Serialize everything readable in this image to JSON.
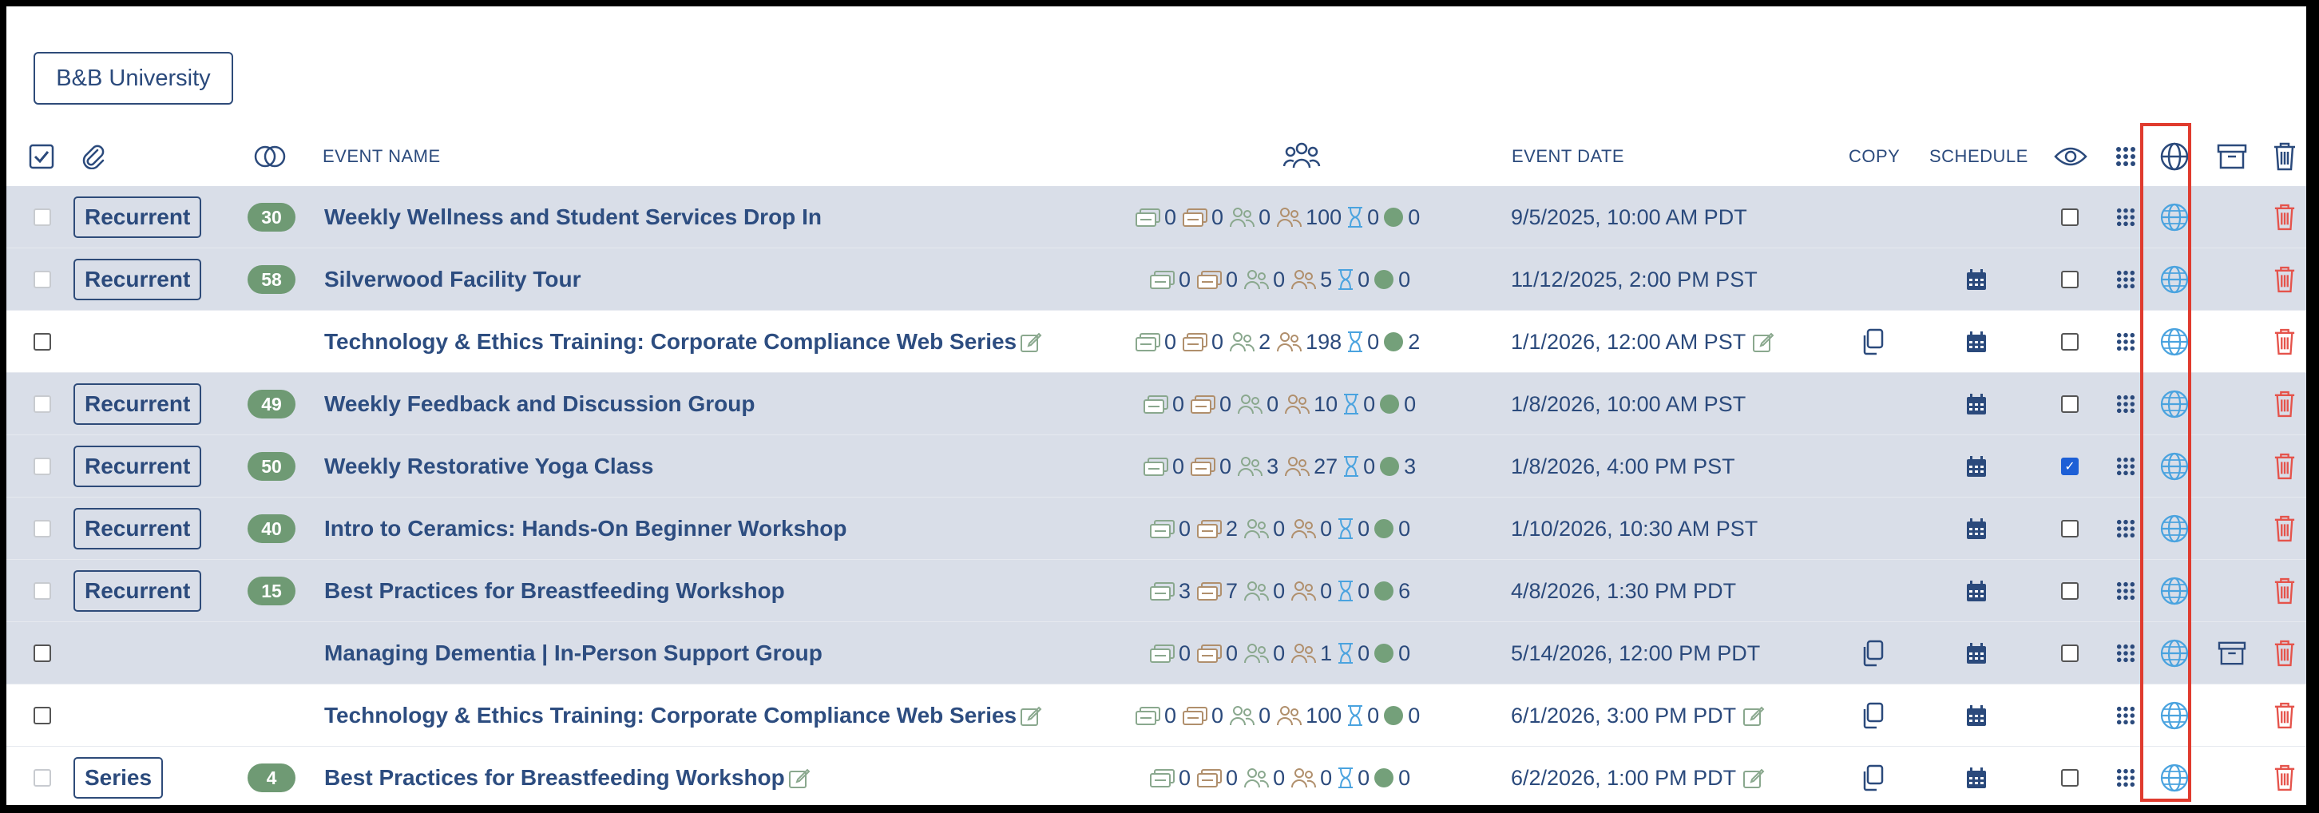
{
  "org_button": "B&B University",
  "header": {
    "event_name": "EVENT NAME",
    "event_date": "EVENT DATE",
    "copy": "COPY",
    "schedule": "SCHEDULE"
  },
  "icons": {
    "select_all": "checkbox-checked-icon",
    "attachment": "paperclip-icon",
    "series": "overlapping-circles-icon",
    "attendees": "people-group-icon",
    "visibility": "eye-icon",
    "qr": "qr-grid-icon",
    "web": "globe-icon",
    "archive": "archive-box-icon",
    "delete": "trash-icon"
  },
  "colors": {
    "primary": "#2b4a7c",
    "badge": "#6f9a74",
    "globe": "#4aa3df",
    "trash": "#e5534b",
    "shaded_row": "#d9dee8",
    "highlight": "#e03b2e"
  },
  "rows": [
    {
      "tag": "Recurrent",
      "badge": "30",
      "name": "Weekly Wellness and Student Services Drop In",
      "s1": "0",
      "s2": "0",
      "s3": "0",
      "s4": "100",
      "s5": "0",
      "s6": "0",
      "date": "9/5/2025, 10:00 AM PDT"
    },
    {
      "tag": "Recurrent",
      "badge": "58",
      "name": "Silverwood Facility Tour",
      "s1": "0",
      "s2": "0",
      "s3": "0",
      "s4": "5",
      "s5": "0",
      "s6": "0",
      "date": "11/12/2025, 2:00 PM PST"
    },
    {
      "tag": "",
      "badge": "",
      "name": "Technology & Ethics Training: Corporate Compliance Web Series",
      "s1": "0",
      "s2": "0",
      "s3": "2",
      "s4": "198",
      "s5": "0",
      "s6": "2",
      "date": "1/1/2026, 12:00 AM PST"
    },
    {
      "tag": "Recurrent",
      "badge": "49",
      "name": "Weekly Feedback and Discussion Group",
      "s1": "0",
      "s2": "0",
      "s3": "0",
      "s4": "10",
      "s5": "0",
      "s6": "0",
      "date": "1/8/2026, 10:00 AM PST"
    },
    {
      "tag": "Recurrent",
      "badge": "50",
      "name": "Weekly Restorative Yoga Class",
      "s1": "0",
      "s2": "0",
      "s3": "3",
      "s4": "27",
      "s5": "0",
      "s6": "3",
      "date": "1/8/2026, 4:00 PM PST"
    },
    {
      "tag": "Recurrent",
      "badge": "40",
      "name": "Intro to Ceramics: Hands-On Beginner Workshop",
      "s1": "0",
      "s2": "2",
      "s3": "0",
      "s4": "0",
      "s5": "0",
      "s6": "0",
      "date": "1/10/2026, 10:30 AM PST"
    },
    {
      "tag": "Recurrent",
      "badge": "15",
      "name": "Best Practices for Breastfeeding Workshop",
      "s1": "3",
      "s2": "7",
      "s3": "0",
      "s4": "0",
      "s5": "0",
      "s6": "6",
      "date": "4/8/2026, 1:30 PM PDT"
    },
    {
      "tag": "",
      "badge": "",
      "name": "Managing Dementia | In-Person Support Group",
      "s1": "0",
      "s2": "0",
      "s3": "0",
      "s4": "1",
      "s5": "0",
      "s6": "0",
      "date": "5/14/2026, 12:00 PM PDT"
    },
    {
      "tag": "",
      "badge": "",
      "name": "Technology & Ethics Training: Corporate Compliance Web Series",
      "s1": "0",
      "s2": "0",
      "s3": "0",
      "s4": "100",
      "s5": "0",
      "s6": "0",
      "date": "6/1/2026, 3:00 PM PDT"
    },
    {
      "tag": "Series",
      "badge": "4",
      "name": "Best Practices for Breastfeeding Workshop",
      "s1": "0",
      "s2": "0",
      "s3": "0",
      "s4": "0",
      "s5": "0",
      "s6": "0",
      "date": "6/2/2026, 1:00 PM PDT"
    }
  ]
}
